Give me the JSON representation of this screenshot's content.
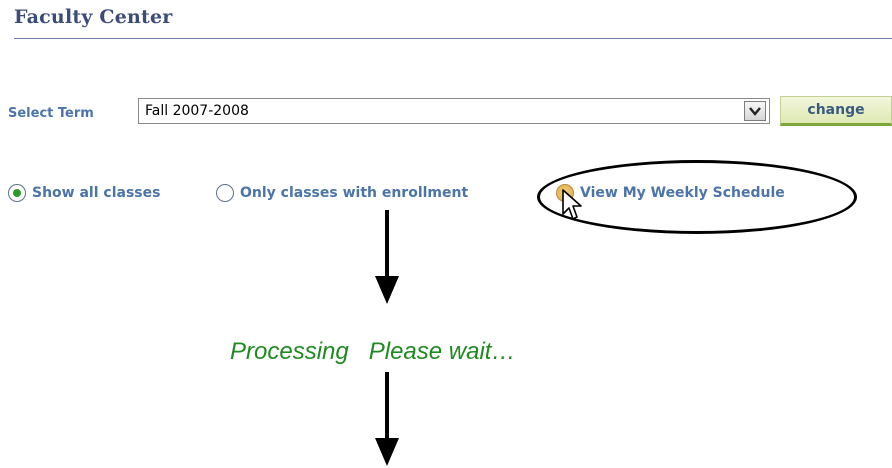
{
  "header": {
    "title": "Faculty Center"
  },
  "term": {
    "label": "Select Term",
    "selected": "Fall 2007-2008",
    "change_label": "change"
  },
  "view_options": [
    {
      "label": "Show all classes",
      "selected": true
    },
    {
      "label": "Only classes with enrollment",
      "selected": false
    },
    {
      "label": "View My Weekly Schedule",
      "selected": false
    }
  ],
  "annotation": {
    "processing_text": "Processing   Please wait…"
  },
  "colors": {
    "label_blue": "#4b74a8",
    "title_navy": "#3b4b7a",
    "processing_green": "#1f8a1f",
    "change_button_green": "#7fa63c"
  },
  "icons": {
    "dropdown": "chevron-down-icon",
    "cursor": "mouse-pointer-icon",
    "arrows": "arrow-down-icon"
  }
}
